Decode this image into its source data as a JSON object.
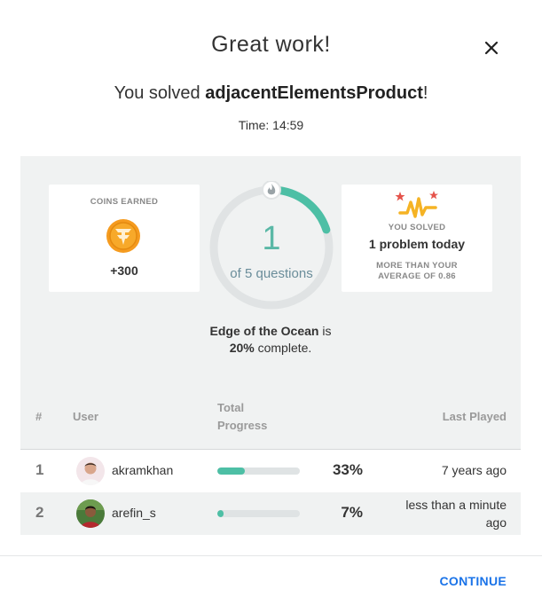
{
  "header": {
    "title": "Great work!",
    "close_icon": "close-icon"
  },
  "summary": {
    "prefix": "You solved ",
    "task_name": "adjacentElementsProduct",
    "suffix": "!",
    "time": "Time: 14:59"
  },
  "coins": {
    "label": "COINS EARNED",
    "icon": "coin-icon",
    "value": "+300"
  },
  "progress": {
    "current": "1",
    "subtitle": "of 5 questions",
    "fraction": 0.2,
    "icon": "flame-icon"
  },
  "solved_card": {
    "icon": "streak-icon",
    "label": "YOU SOLVED",
    "count_text": "1 problem today",
    "avg_line1": "MORE THAN YOUR",
    "avg_line2": "AVERAGE OF 0.86"
  },
  "arcade": {
    "name": "Edge of the Ocean",
    "mid": " is",
    "percent": "20%",
    "tail": " complete."
  },
  "table": {
    "headers": {
      "rank": "#",
      "user": "User",
      "progress_line1": "Total",
      "progress_line2": "Progress",
      "last_played": "Last Played"
    },
    "rows": [
      {
        "rank": "1",
        "user": "akramkhan",
        "progress": 0.33,
        "percent": "33%",
        "last_played": "7 years ago"
      },
      {
        "rank": "2",
        "user": "arefin_s",
        "progress": 0.07,
        "percent": "7%",
        "last_played_line1": "less than a minute",
        "last_played_line2": "ago"
      }
    ]
  },
  "footer": {
    "continue_label": "CONTINUE"
  },
  "colors": {
    "accent": "#4dbfa5",
    "link": "#1a73e8",
    "panel": "#f0f2f2"
  }
}
